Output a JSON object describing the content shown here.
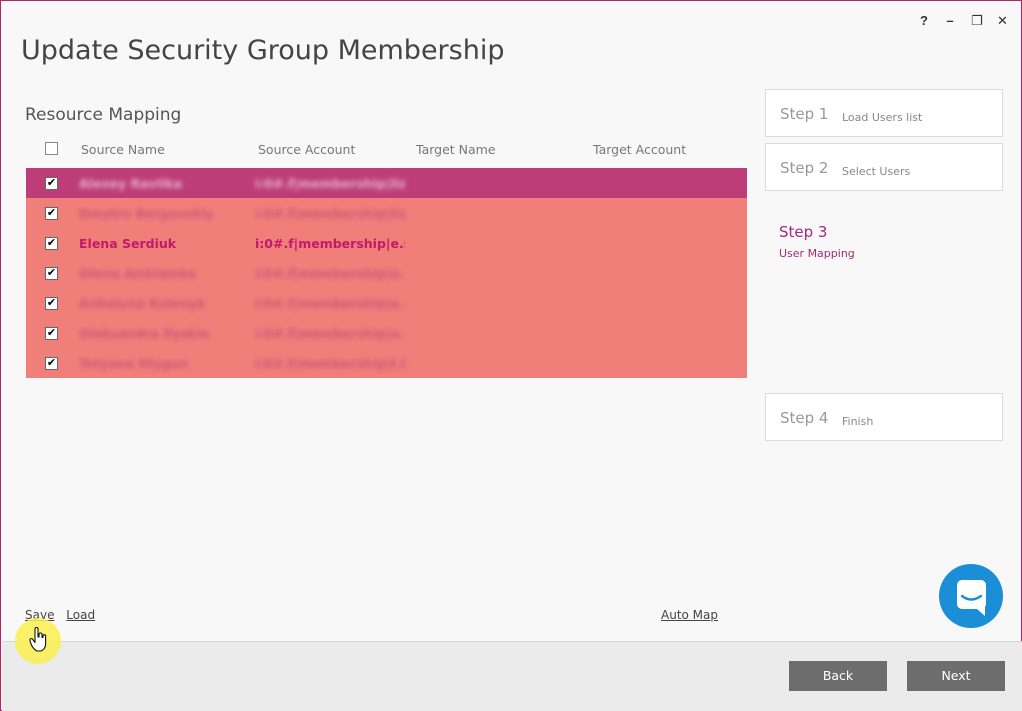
{
  "window": {
    "help_icon": "?",
    "minimize_icon": "–",
    "restore_icon": "❐",
    "close_icon": "✕"
  },
  "dialog": {
    "title": "Update Security Group Membership"
  },
  "mapping": {
    "title": "Resource Mapping",
    "columns": [
      "Source Name",
      "Source Account",
      "Target Name",
      "Target Account"
    ],
    "header_checkbox_checked": false,
    "rows": [
      {
        "checked": true,
        "source_name": "Alexey Ravlika",
        "source_account": "i:0#.f|membership|lizk...",
        "selected": true,
        "blurred": true
      },
      {
        "checked": true,
        "source_name": "Dmytro Bergovskiy",
        "source_account": "i:0#.f|membership|lizk...",
        "selected": false,
        "blurred": true
      },
      {
        "checked": true,
        "source_name": "Elena Serdiuk",
        "source_account": "i:0#.f|membership|e.s...",
        "selected": false,
        "blurred": false
      },
      {
        "checked": true,
        "source_name": "Olena Andrienko",
        "source_account": "i:0#.f|membership|o.a...",
        "selected": false,
        "blurred": true
      },
      {
        "checked": true,
        "source_name": "Anhelyna Kolenyk",
        "source_account": "i:0#.f|membership|a.k...",
        "selected": false,
        "blurred": true
      },
      {
        "checked": true,
        "source_name": "Oleksandra Ilyskin",
        "source_account": "i:0#.f|membership|o.i...",
        "selected": false,
        "blurred": true
      },
      {
        "checked": true,
        "source_name": "Tetyana Hlygun",
        "source_account": "i:0#.f|membership|t.h...",
        "selected": false,
        "blurred": true
      }
    ]
  },
  "steps": [
    {
      "num": "Step 1",
      "label": "Load Users list"
    },
    {
      "num": "Step 2",
      "label": "Select Users"
    },
    {
      "num": "Step 3",
      "label": "User Mapping"
    },
    {
      "num": "Step 4",
      "label": "Finish"
    }
  ],
  "links": {
    "save": "Save",
    "load": "Load",
    "auto_map": "Auto Map"
  },
  "footer": {
    "back": "Back",
    "next": "Next"
  },
  "colors": {
    "accent": "#a32a78",
    "row_bg": "#f07e79",
    "row_selected_bg": "#bd3d78",
    "chat_button": "#1a8ed6"
  },
  "icons": {
    "chat": "chat-bubble-icon",
    "cursor": "hand-pointer-icon"
  }
}
